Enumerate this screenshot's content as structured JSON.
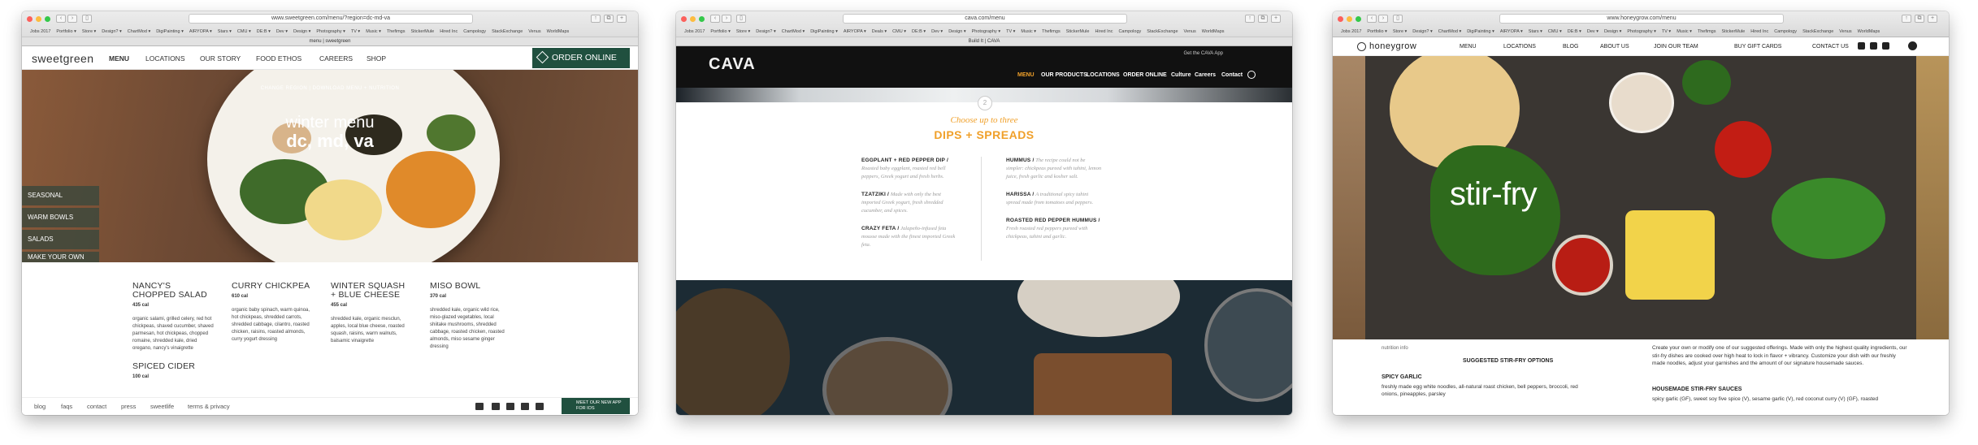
{
  "windows": [
    {
      "url": "www.sweetgreen.com/menu/?region=dc-md-va",
      "tab": "menu | sweetgreen",
      "bookmarks": [
        "Jobs 2017",
        "Portfolio ▾",
        "Store ▾",
        "Design? ▾",
        "ChartMod ▾",
        "DigiPainting ▾",
        "AIRYOPA ▾",
        "Stars ▾",
        "CMU ▾",
        "DE:B ▾",
        "Dev ▾",
        "Design ▾",
        "Photography ▾",
        "TV ▾",
        "Music ▾",
        "Thefimgs",
        "StickerMule",
        "Hired Inc",
        "Campology",
        "StackExchange",
        "Venus",
        "WorldMaps"
      ],
      "logo": "sweetgreen",
      "nav": [
        "MENU",
        "LOCATIONS",
        "OUR STORY",
        "FOOD ETHOS",
        "CAREERS",
        "SHOP"
      ],
      "order_label": "ORDER ONLINE",
      "hero_links": "CHANGE REGION  |  DOWNLOAD MENU + NUTRITION",
      "hero_title": "winter menu",
      "hero_subtitle": "dc, md, va",
      "side_menu": [
        "SEASONAL",
        "WARM BOWLS",
        "SALADS",
        "MAKE YOUR OWN"
      ],
      "items": [
        {
          "name": "NANCY'S CHOPPED SALAD",
          "cal": "435 cal",
          "desc": "organic salami, grilled celery, red hot chickpeas, shaved cucumber, shaved parmesan, hot chickpeas, chopped romaine, shredded kale, dried oregano, nancy's vinaigrette"
        },
        {
          "name": "CURRY CHICKPEA",
          "cal": "610 cal",
          "desc": "organic baby spinach, warm quinoa, hot chickpeas, shredded carrots, shredded cabbage, cilantro, roasted chicken, raisins, roasted almonds, curry yogurt dressing"
        },
        {
          "name": "WINTER SQUASH + BLUE CHEESE",
          "cal": "455 cal",
          "desc": "shredded kale, organic mesclun, apples, local blue cheese, roasted squash, raisins, warm walnuts, balsamic vinaigrette"
        },
        {
          "name": "MISO BOWL",
          "cal": "370 cal",
          "desc": "shredded kale, organic wild rice, miso-glazed vegetables, local shiitake mushrooms, shredded cabbage, roasted chicken, roasted almonds, miso sesame ginger dressing"
        },
        {
          "name": "SPICED CIDER",
          "cal": "100 cal",
          "desc": ""
        }
      ],
      "footer_links": [
        "blog",
        "faqs",
        "contact",
        "press",
        "sweetlife",
        "terms & privacy"
      ],
      "footer_app": "MEET OUR NEW APP FOR IOS"
    },
    {
      "url": "cava.com/menu",
      "tab": "Build It | CAVA",
      "bookmarks": [
        "Jobs 2017",
        "Portfolio ▾",
        "Store ▾",
        "Design? ▾",
        "ChartMod ▾",
        "DigiPainting ▾",
        "AIRYOPA ▾",
        "Deals ▾",
        "CMU ▾",
        "DE:B ▾",
        "Dev ▾",
        "Design ▾",
        "Photography ▾",
        "TV ▾",
        "Music ▾",
        "Thefimgs",
        "StickerMule",
        "Hired Inc",
        "Campology",
        "StackExchange",
        "Venus",
        "WorldMaps"
      ],
      "logo": "CAVA",
      "app_text": "Get the CAVA App",
      "nav": [
        "MENU",
        "OUR PRODUCTS",
        "LOCATIONS",
        "ORDER ONLINE",
        "Culture",
        "Careers",
        "Contact"
      ],
      "step": "2",
      "choose": "Choose up to three",
      "heading": "DIPS + SPREADS",
      "left": [
        {
          "name": "EGGPLANT + RED PEPPER DIP /",
          "desc": "Roasted baby eggplant, roasted red bell peppers, Greek yogurt and fresh herbs."
        },
        {
          "name": "TZATZIKI /",
          "desc": "Made with only the best imported Greek yogurt, fresh shredded cucumber, and spices."
        },
        {
          "name": "CRAZY FETA /",
          "desc": "Jalapeño-infused feta mousse made with the finest imported Greek feta."
        }
      ],
      "right": [
        {
          "name": "HUMMUS /",
          "desc": "The recipe could not be simpler: chickpeas pureed with tahini, lemon juice, fresh garlic and kosher salt."
        },
        {
          "name": "HARISSA /",
          "desc": "A traditional spicy tahini spread made from tomatoes and peppers."
        },
        {
          "name": "ROASTED RED PEPPER HUMMUS /",
          "desc": "Fresh roasted red peppers pureed with chickpeas, tahini and garlic."
        }
      ]
    },
    {
      "url": "www.honeygrow.com/menu",
      "bookmarks": [
        "Jobs 2017",
        "Portfolio ▾",
        "Store ▾",
        "Design? ▾",
        "ChartMod ▾",
        "DigiPainting ▾",
        "AIRYOPA ▾",
        "Stars ▾",
        "CMU ▾",
        "DE:B ▾",
        "Dev ▾",
        "Design ▾",
        "Photography ▾",
        "TV ▾",
        "Music ▾",
        "Thefimgs",
        "StickerMule",
        "Hired Inc",
        "Campology",
        "StackExchange",
        "Venus",
        "WorldMaps"
      ],
      "logo": "honeygrow",
      "nav": [
        "MENU",
        "LOCATIONS",
        "BLOG",
        "ABOUT US",
        "JOIN OUR TEAM",
        "BUY GIFT CARDS",
        "CONTACT US"
      ],
      "hero_title": "stir-fry",
      "nutrition": "nutrition info",
      "suggested": "SUGGESTED STIR-FRY OPTIONS",
      "spicy_title": "SPICY GARLIC",
      "spicy_desc": "freshly made egg white noodles, all-natural roast chicken, bell peppers, broccoli, red onions, pineapples, parsley",
      "intro": "Create your own or modify one of our suggested offerings. Made with only the highest quality ingredients, our stir-fry dishes are cooked over high heat to lock in flavor + vibrancy. Customize your dish with our freshly made noodles, adjust your garnishes and the amount of our signature housemade sauces.",
      "sauces_title": "HOUSEMADE STIR-FRY SAUCES",
      "sauces_desc": "spicy garlic (GF), sweet soy five spice (V), sesame garlic (V), red coconut curry (V) (GF), roasted"
    }
  ]
}
